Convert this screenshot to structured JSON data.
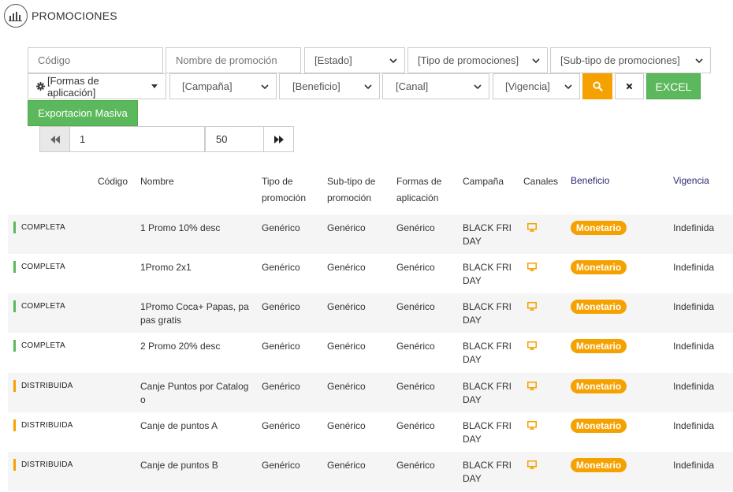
{
  "header": {
    "title": "PROMOCIONES",
    "icon": "bar-chart-icon"
  },
  "filters": {
    "codigo_placeholder": "Código",
    "nombre_placeholder": "Nombre de promoción",
    "estado": "[Estado]",
    "tipo": "[Tipo de promociones]",
    "subtipo": "[Sub-tipo de promociones]",
    "formas": "[Formas de aplicación]",
    "campana": "[Campaña]",
    "beneficio": "[Beneficio]",
    "canal": "[Canal]",
    "vigencia": "[Vigencia]",
    "excel_label": "EXCEL",
    "export_label": "Exportacion Masiva",
    "colors": {
      "search": "#f5a100",
      "excel": "#5cb85c"
    }
  },
  "pager": {
    "page": "1",
    "page_size": "50"
  },
  "columns": {
    "codigo": "Código",
    "nombre": "Nombre",
    "tipo_l1": "Tipo de",
    "tipo_l2": "promoción",
    "subtipo_l1": "Sub-tipo de",
    "subtipo_l2": "promoción",
    "formas_l1": "Formas de",
    "formas_l2": "aplicación",
    "campana": "Campaña",
    "canales": "Canales",
    "beneficio": "Beneficio",
    "vigencia": "Vigencia"
  },
  "status_colors": {
    "COMPLETA": "#5cb85c",
    "DISTRIBUIDA": "#f5a100"
  },
  "rows": [
    {
      "status": "COMPLETA",
      "nombre": "1 Promo 10% desc",
      "tipo": "Genérico",
      "subtipo": "Genérico",
      "formas": "Genérico",
      "campana": "BLACK FRIDAY",
      "beneficio": "Monetario",
      "vigencia": "Indefinida"
    },
    {
      "status": "COMPLETA",
      "nombre": "1Promo 2x1",
      "tipo": "Genérico",
      "subtipo": "Genérico",
      "formas": "Genérico",
      "campana": "BLACK FRIDAY",
      "beneficio": "Monetario",
      "vigencia": "Indefinida"
    },
    {
      "status": "COMPLETA",
      "nombre": "1Promo Coca+ Papas, papas gratis",
      "tipo": "Genérico",
      "subtipo": "Genérico",
      "formas": "Genérico",
      "campana": "BLACK FRIDAY",
      "beneficio": "Monetario",
      "vigencia": "Indefinida"
    },
    {
      "status": "COMPLETA",
      "nombre": "2 Promo 20% desc",
      "tipo": "Genérico",
      "subtipo": "Genérico",
      "formas": "Genérico",
      "campana": "BLACK FRIDAY",
      "beneficio": "Monetario",
      "vigencia": "Indefinida"
    },
    {
      "status": "DISTRIBUIDA",
      "nombre": "Canje Puntos por Catalogo",
      "tipo": "Genérico",
      "subtipo": "Genérico",
      "formas": "Genérico",
      "campana": "BLACK FRIDAY",
      "beneficio": "Monetario",
      "vigencia": "Indefinida"
    },
    {
      "status": "DISTRIBUIDA",
      "nombre": "Canje de puntos A",
      "tipo": "Genérico",
      "subtipo": "Genérico",
      "formas": "Genérico",
      "campana": "BLACK FRIDAY",
      "beneficio": "Monetario",
      "vigencia": "Indefinida"
    },
    {
      "status": "DISTRIBUIDA",
      "nombre": "Canje de puntos B",
      "tipo": "Genérico",
      "subtipo": "Genérico",
      "formas": "Genérico",
      "campana": "BLACK FRIDAY",
      "beneficio": "Monetario",
      "vigencia": "Indefinida"
    }
  ]
}
